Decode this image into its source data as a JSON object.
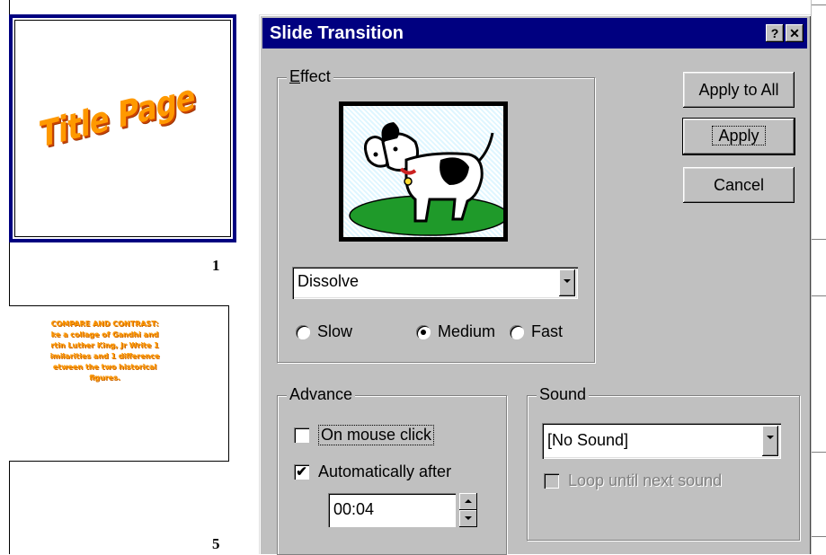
{
  "sorter": {
    "slide1_title": "Title Page",
    "slide1_number": "1",
    "slide2_lines": [
      "COMPARE AND CONTRAST:",
      "ke a collage of Gandhi and",
      "rtin Luther King, Jr Write 1",
      "imilarities and 1 difference",
      "etween the two historical",
      "figures."
    ],
    "slide2_number": "5"
  },
  "dialog": {
    "title": "Slide Transition",
    "help_label": "?",
    "close_label": "✕",
    "buttons": {
      "apply_all": "Apply to All",
      "apply": "Apply",
      "cancel": "Cancel"
    },
    "effect": {
      "legend": "Effect",
      "selected": "Dissolve",
      "speeds": [
        "Slow",
        "Medium",
        "Fast"
      ],
      "selected_speed": "Medium"
    },
    "advance": {
      "legend": "Advance",
      "mouse_click_label": "On mouse click",
      "mouse_click_checked": false,
      "auto_label": "Automatically after",
      "auto_checked": true,
      "auto_time": "00:04"
    },
    "sound": {
      "legend": "Sound",
      "selected": "[No Sound]",
      "loop_label": "Loop until next sound",
      "loop_checked": false,
      "loop_enabled": false
    }
  },
  "colors": {
    "titlebar": "#000080",
    "face": "#c0c0c0",
    "wordart": "#ff9900"
  },
  "icons": {
    "preview": "dog-picture-icon",
    "help": "help-icon",
    "close": "close-icon"
  }
}
